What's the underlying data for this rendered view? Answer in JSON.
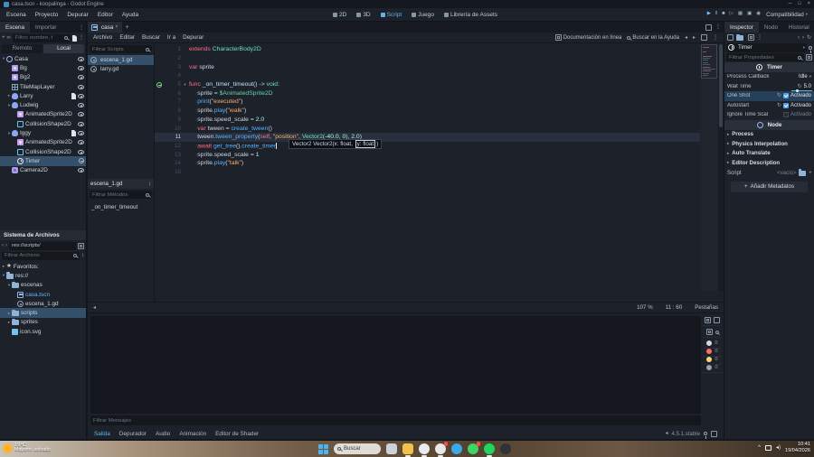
{
  "titlebar": {
    "title": "casa.tscn - koopalinga - Godot Engine",
    "controls": [
      "─",
      "□",
      "×"
    ]
  },
  "menubar": {
    "menus": [
      "Escena",
      "Proyecto",
      "Depurar",
      "Editor",
      "Ayuda"
    ],
    "workspaces": [
      {
        "label": "2D",
        "active": false
      },
      {
        "label": "3D",
        "active": false
      },
      {
        "label": "Script",
        "active": true
      },
      {
        "label": "Juego",
        "active": false
      },
      {
        "label": "Librería de Assets",
        "active": false
      }
    ],
    "playback": [
      {
        "name": "play-button",
        "glyph": "▶",
        "accent": true
      },
      {
        "name": "pause-button",
        "glyph": "‖",
        "accent": false
      },
      {
        "name": "stop-button",
        "glyph": "■",
        "accent": false
      },
      {
        "name": "play-scene-button",
        "glyph": "▷",
        "accent": false
      },
      {
        "name": "play-custom-scene-button",
        "glyph": "▦",
        "accent": false
      },
      {
        "name": "movie-mode-button",
        "glyph": "▣",
        "accent": false
      },
      {
        "name": "remote-debug-button",
        "glyph": "◉",
        "accent": false
      }
    ],
    "renderer": "Compatibilidad"
  },
  "scene_dock": {
    "tabs": [
      {
        "label": "Escena",
        "active": true
      },
      {
        "label": "Importar",
        "active": false
      }
    ],
    "filter_placeholder": "Filtro: nombre, t",
    "view_tabs": [
      {
        "label": "Remoto",
        "active": false
      },
      {
        "label": "Local",
        "active": true
      }
    ],
    "tree": [
      {
        "label": "Casa",
        "icon": "node2d",
        "depth": 0,
        "arrow": "v",
        "right": "eye"
      },
      {
        "label": "Bg",
        "icon": "sprite",
        "depth": 1,
        "arrow": "",
        "right": "eye"
      },
      {
        "label": "Bg2",
        "icon": "sprite",
        "depth": 1,
        "arrow": "",
        "right": "eye"
      },
      {
        "label": "TileMapLayer",
        "icon": "tile",
        "depth": 1,
        "arrow": "",
        "right": "eye"
      },
      {
        "label": "Larry",
        "icon": "char",
        "depth": 1,
        "arrow": "r",
        "script": true,
        "right": "eye"
      },
      {
        "label": "Ludwig",
        "icon": "char",
        "depth": 1,
        "arrow": "v",
        "right": "eye"
      },
      {
        "label": "AnimatedSprite2D",
        "icon": "anim",
        "depth": 2,
        "arrow": "",
        "right": "eye"
      },
      {
        "label": "CollisionShape2D",
        "icon": "coll",
        "depth": 2,
        "arrow": "",
        "right": "eye"
      },
      {
        "label": "Iggy",
        "icon": "char",
        "depth": 1,
        "arrow": "v",
        "script": true,
        "right": "eye"
      },
      {
        "label": "AnimatedSprite2D",
        "icon": "anim",
        "depth": 2,
        "arrow": "",
        "right": "eye"
      },
      {
        "label": "CollisionShape2D",
        "icon": "coll",
        "depth": 2,
        "arrow": "",
        "right": "eye"
      },
      {
        "label": "Timer",
        "icon": "timer",
        "depth": 2,
        "arrow": "",
        "selected": true,
        "right": "conn"
      },
      {
        "label": "Camera2D",
        "icon": "cam",
        "depth": 1,
        "arrow": "",
        "right": "eye"
      }
    ]
  },
  "filesystem": {
    "title": "Sistema de Archivos",
    "path": "res://scripts/",
    "filter_placeholder": "Filtrar Archivos",
    "tree": [
      {
        "label": "Favoritos:",
        "icon": "star",
        "depth": 0,
        "arrow": "r"
      },
      {
        "label": "res://",
        "icon": "folder",
        "depth": 0,
        "arrow": "v"
      },
      {
        "label": "escenas",
        "icon": "folder",
        "depth": 1,
        "arrow": "v"
      },
      {
        "label": "casa.tscn",
        "icon": "scene",
        "depth": 2,
        "arrow": "",
        "blue": true
      },
      {
        "label": "escena_1.gd",
        "icon": "gd",
        "depth": 2,
        "arrow": ""
      },
      {
        "label": "scripts",
        "icon": "folder",
        "depth": 1,
        "arrow": "r",
        "selected": true
      },
      {
        "label": "sprites",
        "icon": "folder",
        "depth": 1,
        "arrow": "r"
      },
      {
        "label": "icon.svg",
        "icon": "img",
        "depth": 1,
        "arrow": ""
      }
    ]
  },
  "scene_tabs": {
    "tab": "casa",
    "close": "×",
    "add": "+"
  },
  "script_list": {
    "filter_placeholder": "Filtrar Scripts",
    "scripts": [
      {
        "name": "escena_1.gd",
        "selected": true,
        "modified": false
      },
      {
        "name": "larry.gd",
        "selected": false,
        "modified": true
      }
    ],
    "current_header": "escena_1.gd",
    "methods_filter": "Filtrar Métodos",
    "methods": [
      "_on_timer_timeout"
    ]
  },
  "editor": {
    "menus": [
      "Archivo",
      "Editar",
      "Buscar",
      "Ir a",
      "Depurar"
    ],
    "links": [
      "Documentación en línea",
      "Buscar en la Ayuda"
    ],
    "lines": [
      {
        "n": 1,
        "ind": 0,
        "t": [
          [
            "extends",
            "kw"
          ],
          [
            " ",
            ""
          ],
          [
            "CharacterBody2D",
            "type"
          ]
        ]
      },
      {
        "n": 2,
        "ind": 0,
        "t": []
      },
      {
        "n": 3,
        "ind": 0,
        "t": [
          [
            "var",
            "kw"
          ],
          [
            " sprite",
            ""
          ]
        ]
      },
      {
        "n": 4,
        "ind": 0,
        "t": []
      },
      {
        "n": 5,
        "ind": 0,
        "conn": true,
        "fold": true,
        "t": [
          [
            "func",
            "kw"
          ],
          [
            " ",
            ""
          ],
          [
            "_on_timer_timeout",
            "fnd"
          ],
          [
            "() -> ",
            ""
          ],
          [
            "void",
            "type"
          ],
          [
            ":",
            ""
          ]
        ]
      },
      {
        "n": 6,
        "ind": 1,
        "t": [
          [
            "sprite = ",
            ""
          ],
          [
            "$AnimatedSprite2D",
            "path"
          ]
        ]
      },
      {
        "n": 7,
        "ind": 1,
        "t": [
          [
            "print",
            "fn"
          ],
          [
            "(",
            ""
          ],
          [
            "\"executed\"",
            "str"
          ],
          [
            ")",
            ""
          ]
        ]
      },
      {
        "n": 8,
        "ind": 1,
        "t": [
          [
            "sprite.",
            ""
          ],
          [
            "play",
            "fn"
          ],
          [
            "(",
            ""
          ],
          [
            "\"walk\"",
            "str"
          ],
          [
            ")",
            ""
          ]
        ]
      },
      {
        "n": 9,
        "ind": 1,
        "t": [
          [
            "sprite.speed_scale = ",
            ""
          ],
          [
            "2.0",
            "num"
          ]
        ]
      },
      {
        "n": 10,
        "ind": 1,
        "t": [
          [
            "var",
            "kw"
          ],
          [
            " tween = ",
            ""
          ],
          [
            "create_tween",
            "fn"
          ],
          [
            "()",
            ""
          ]
        ]
      },
      {
        "n": 11,
        "ind": 1,
        "cur": true,
        "t": [
          [
            "tween.",
            ""
          ],
          [
            "tween_property",
            "fn"
          ],
          [
            "(",
            ""
          ],
          [
            "self",
            "kw"
          ],
          [
            ", ",
            ""
          ],
          [
            "\"position\"",
            "str"
          ],
          [
            ", ",
            ""
          ],
          [
            "Vector2",
            "type"
          ],
          [
            "(",
            ""
          ],
          [
            "-40.0",
            "num"
          ],
          [
            ", ",
            ""
          ],
          [
            "0",
            "num"
          ],
          [
            "), ",
            ""
          ],
          [
            "2.0",
            "num"
          ],
          [
            ")",
            ""
          ]
        ]
      },
      {
        "n": 12,
        "ind": 1,
        "caret": true,
        "t": [
          [
            "await",
            "kw"
          ],
          [
            " ",
            ""
          ],
          [
            "get_tree",
            "fn"
          ],
          [
            "().",
            ""
          ],
          [
            "create_timer",
            "fn"
          ]
        ]
      },
      {
        "n": 13,
        "ind": 1,
        "t": [
          [
            "sprite.speed_scale = ",
            ""
          ],
          [
            "1",
            "num"
          ]
        ]
      },
      {
        "n": 14,
        "ind": 1,
        "t": [
          [
            "sprite.",
            ""
          ],
          [
            "play",
            "fn"
          ],
          [
            "(",
            ""
          ],
          [
            "\"talk\"",
            "str"
          ],
          [
            ")",
            ""
          ]
        ]
      },
      {
        "n": 15,
        "ind": 0,
        "t": []
      }
    ],
    "tooltip": {
      "prefix": "Vector2 Vector2(x: float, ",
      "highlight": "y: float",
      "suffix": ")"
    },
    "status": {
      "zoom": "107 %",
      "cursor": "11 : 60",
      "indent": "Pestañas"
    }
  },
  "inspector": {
    "tabs": [
      {
        "label": "Inspector",
        "active": true
      },
      {
        "label": "Nodo",
        "active": false
      },
      {
        "label": "Historial",
        "active": false
      }
    ],
    "object": "Timer",
    "filter_placeholder": "Filtrar Propiedades",
    "category_timer": "Timer",
    "props": [
      {
        "label": "Process Callback",
        "type": "enum",
        "value": "Idle"
      },
      {
        "label": "Wait Time",
        "type": "float",
        "value": "5.0",
        "revert": true
      },
      {
        "label": "One Shot",
        "type": "bool",
        "value": "Activado",
        "checked": true,
        "revert": true,
        "highlight": true
      },
      {
        "label": "Autostart",
        "type": "bool",
        "value": "Activado",
        "checked": true,
        "revert": true
      },
      {
        "label": "Ignore Time Scal",
        "type": "bool",
        "value": "Activado",
        "checked": false
      }
    ],
    "category_node": "Node",
    "groups": [
      "Process",
      "Physics Interpolation",
      "Auto Translate",
      "Editor Description"
    ],
    "script_label": "Script",
    "script_value": "<vacío>",
    "add_metadata": "Añadir Metadatos"
  },
  "bottom_panel": {
    "filter_placeholder": "Filtrar Mensajes",
    "tabs": [
      {
        "label": "Salida",
        "active": true
      },
      {
        "label": "Depurador",
        "active": false
      },
      {
        "label": "Audio",
        "active": false
      },
      {
        "label": "Animación",
        "active": false
      },
      {
        "label": "Editor de Shader",
        "active": false
      }
    ],
    "filters": [
      {
        "name": "messages-filter",
        "color": "#d3d8de",
        "count": "0"
      },
      {
        "name": "errors-filter",
        "color": "#ff6b6b",
        "count": "0"
      },
      {
        "name": "warnings-filter",
        "color": "#ffd866",
        "count": "0"
      },
      {
        "name": "editor-filter",
        "color": "#9aa3ad",
        "count": "0"
      }
    ],
    "version": "4.5.1.stable"
  },
  "taskbar": {
    "weather": {
      "temp": "19°C",
      "desc": "Mayorm. soleado"
    },
    "search_placeholder": "Buscar",
    "apps": [
      {
        "name": "task-view",
        "color": "#cdd2d8",
        "shape": "square"
      },
      {
        "name": "file-explorer",
        "color": "#f3c14b",
        "shape": "square",
        "open": true
      },
      {
        "name": "godot",
        "color": "#e9ecef",
        "shape": "circle",
        "open": true
      },
      {
        "name": "chrome",
        "color": "#e8e8e8",
        "shape": "circle",
        "badge": "#ff4b4b",
        "open": true
      },
      {
        "name": "telegram",
        "color": "#3aa9e8",
        "shape": "circle"
      },
      {
        "name": "whatsapp",
        "color": "#41d366",
        "shape": "circle",
        "badge": "#ff4b4b"
      },
      {
        "name": "spotify",
        "color": "#1ed760",
        "shape": "circle",
        "open": true
      },
      {
        "name": "epic-games",
        "color": "#2f3338",
        "shape": "circle"
      }
    ],
    "clock": {
      "time": "10:41",
      "date": "19/04/2026"
    }
  }
}
